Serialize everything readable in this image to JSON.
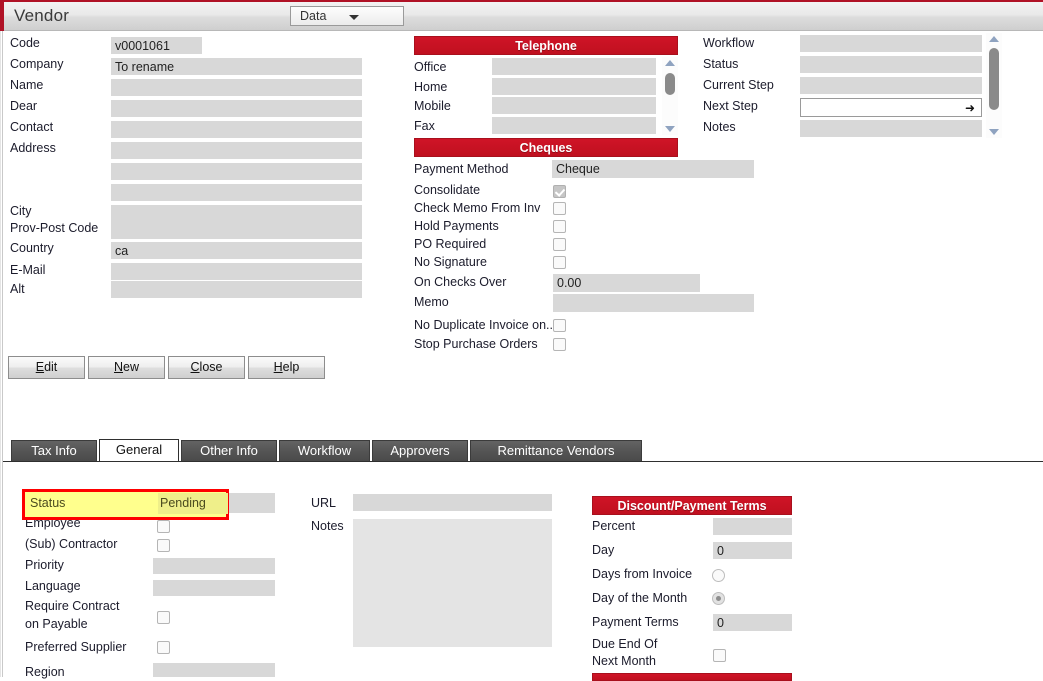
{
  "window": {
    "title": "Vendor",
    "data_menu": "Data"
  },
  "vendor_form": {
    "fields": [
      {
        "label": "Code",
        "value": "v0001061"
      },
      {
        "label": "Company",
        "value": "To rename"
      },
      {
        "label": "Name",
        "value": ""
      },
      {
        "label": "Dear",
        "value": ""
      },
      {
        "label": "Contact",
        "value": ""
      },
      {
        "label": "Address",
        "value": ""
      },
      {
        "label": "",
        "value": ""
      },
      {
        "label": "City",
        "value": ""
      },
      {
        "label": "Prov-Post Code",
        "value": ""
      },
      {
        "label": "Country",
        "value": "ca"
      },
      {
        "label": "E-Mail",
        "value": ""
      },
      {
        "label": "Alt",
        "value": ""
      }
    ]
  },
  "buttons": [
    {
      "label": "Edit",
      "accel": "E"
    },
    {
      "label": "New",
      "accel": "N"
    },
    {
      "label": "Close",
      "accel": "C"
    },
    {
      "label": "Help",
      "accel": "H"
    }
  ],
  "telephone": {
    "header": "Telephone",
    "rows": [
      {
        "label": "Office",
        "value": ""
      },
      {
        "label": "Home",
        "value": ""
      },
      {
        "label": "Mobile",
        "value": ""
      },
      {
        "label": "Fax",
        "value": ""
      }
    ]
  },
  "cheques": {
    "header": "Cheques",
    "payment_method": {
      "label": "Payment Method",
      "value": "Cheque"
    },
    "checkboxes": [
      {
        "label": "Consolidate",
        "checked": true
      },
      {
        "label": "Check Memo From Inv",
        "checked": false
      },
      {
        "label": "Hold Payments",
        "checked": false
      },
      {
        "label": "PO Required",
        "checked": false
      },
      {
        "label": "No Signature",
        "checked": false
      }
    ],
    "on_checks_over": {
      "label": "On Checks Over",
      "value": "0.00"
    },
    "memo": {
      "label": "Memo",
      "value": ""
    },
    "tail_checkboxes": [
      {
        "label": "No Duplicate Invoice on...",
        "checked": false
      },
      {
        "label": "Stop Purchase Orders",
        "checked": false
      }
    ]
  },
  "workflow": {
    "rows": [
      {
        "label": "Workflow",
        "value": ""
      },
      {
        "label": "Status",
        "value": ""
      },
      {
        "label": "Current Step",
        "value": ""
      },
      {
        "label": "Next Step",
        "value": ""
      },
      {
        "label": "Notes",
        "value": ""
      }
    ]
  },
  "tabs": [
    {
      "label": "Tax Info",
      "active": false
    },
    {
      "label": "General",
      "active": true
    },
    {
      "label": "Other Info",
      "active": false
    },
    {
      "label": "Workflow",
      "active": false
    },
    {
      "label": "Approvers",
      "active": false
    },
    {
      "label": "Remittance Vendors",
      "active": false
    }
  ],
  "general_tab": {
    "status": {
      "label": "Status",
      "value": "Pending"
    },
    "rows": [
      {
        "label": "Employee",
        "type": "checkbox",
        "checked": false
      },
      {
        "label": "(Sub) Contractor",
        "type": "checkbox",
        "checked": false
      },
      {
        "label": "Priority",
        "type": "field",
        "value": ""
      },
      {
        "label": "Language",
        "type": "field",
        "value": ""
      },
      {
        "label": "Require Contract",
        "type": "text"
      },
      {
        "label": "on Payable",
        "type": "checkbox",
        "checked": false
      },
      {
        "label": "Preferred Supplier",
        "type": "checkbox",
        "checked": false
      },
      {
        "label": "Region",
        "type": "field",
        "value": ""
      }
    ],
    "url": {
      "label": "URL",
      "value": ""
    },
    "notes": {
      "label": "Notes",
      "value": ""
    }
  },
  "discount_terms": {
    "header": "Discount/Payment Terms",
    "percent": {
      "label": "Percent",
      "value": ""
    },
    "day": {
      "label": "Day",
      "value": "0"
    },
    "days_from_invoice": {
      "label": "Days from Invoice",
      "selected": false
    },
    "day_of_month": {
      "label": "Day of the Month",
      "selected": true
    },
    "payment_terms": {
      "label": "Payment Terms",
      "value": "0"
    },
    "due_end_of": {
      "label": "Due End Of"
    },
    "next_month": {
      "label": "Next Month",
      "checked": false
    }
  },
  "colors": {
    "accent_red": "#c0101f",
    "highlight_yellow": "#ffff8d",
    "highlight_border": "#ff0000",
    "field_gray": "#d8d8d8"
  }
}
